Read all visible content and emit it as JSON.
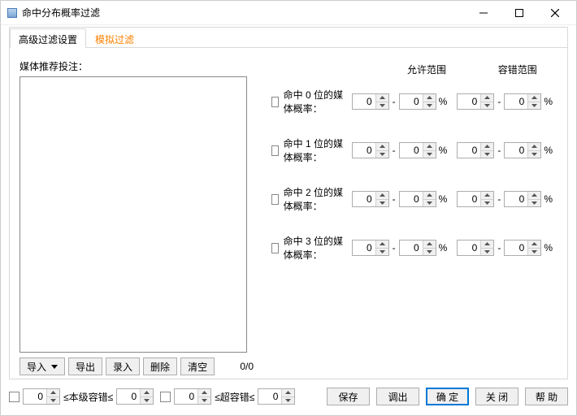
{
  "window": {
    "title": "命中分布概率过滤"
  },
  "tabs": {
    "advanced": "高级过滤设置",
    "simulate": "模拟过滤"
  },
  "left": {
    "label": "媒体推荐投注：",
    "import": "导入",
    "export": "导出",
    "enter": "录入",
    "delete": "删除",
    "clear": "清空",
    "count": "0/0"
  },
  "headers": {
    "allow": "允许范围",
    "tolerance": "容错范围"
  },
  "rows": [
    {
      "label": "命中 0 位的媒体概率：",
      "a1": "0",
      "a2": "0",
      "t1": "0",
      "t2": "0"
    },
    {
      "label": "命中 1 位的媒体概率：",
      "a1": "0",
      "a2": "0",
      "t1": "0",
      "t2": "0"
    },
    {
      "label": "命中 2 位的媒体概率：",
      "a1": "0",
      "a2": "0",
      "t1": "0",
      "t2": "0"
    },
    {
      "label": "命中 3 位的媒体概率：",
      "a1": "0",
      "a2": "0",
      "t1": "0",
      "t2": "0"
    }
  ],
  "bottom": {
    "b1": "0",
    "lbl1": "≤本级容错≤",
    "b2": "0",
    "b3": "0",
    "lbl2": "≤超容错≤",
    "b4": "0",
    "save": "保存",
    "load": "调出",
    "ok": "确 定",
    "close": "关 闭",
    "help": "帮 助"
  },
  "glyph": {
    "pct": "%",
    "dash": "-"
  }
}
